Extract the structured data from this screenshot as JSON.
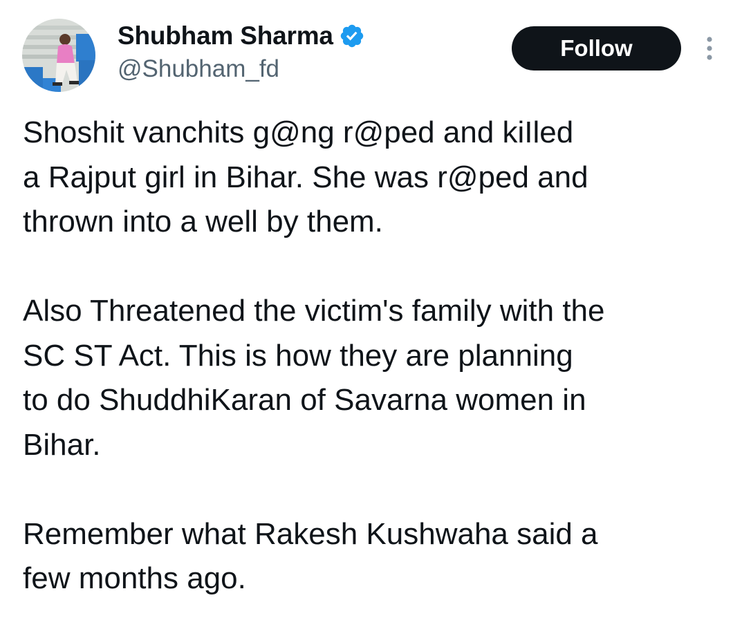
{
  "author": {
    "display_name": "Shubham Sharma",
    "handle": "@Shubham_fd",
    "verified": true,
    "verified_color": "#1d9bf0",
    "avatar_icon": "profile-photo"
  },
  "actions": {
    "follow_label": "Follow",
    "more_icon": "more-vertical-icon"
  },
  "tweet": {
    "paragraphs": [
      "Shoshit vanchits g@ng r@ped and kiIled\na Rajput girl in Bihar. She was r@ped and\nthrown into a well by them.",
      "Also Threatened the victim's family with the\nSC ST Act. This is how they are planning\nto do ShuddhiKaran of Savarna women in\nBihar.",
      "Remember what Rakesh Kushwaha said a\nfew months ago."
    ]
  }
}
